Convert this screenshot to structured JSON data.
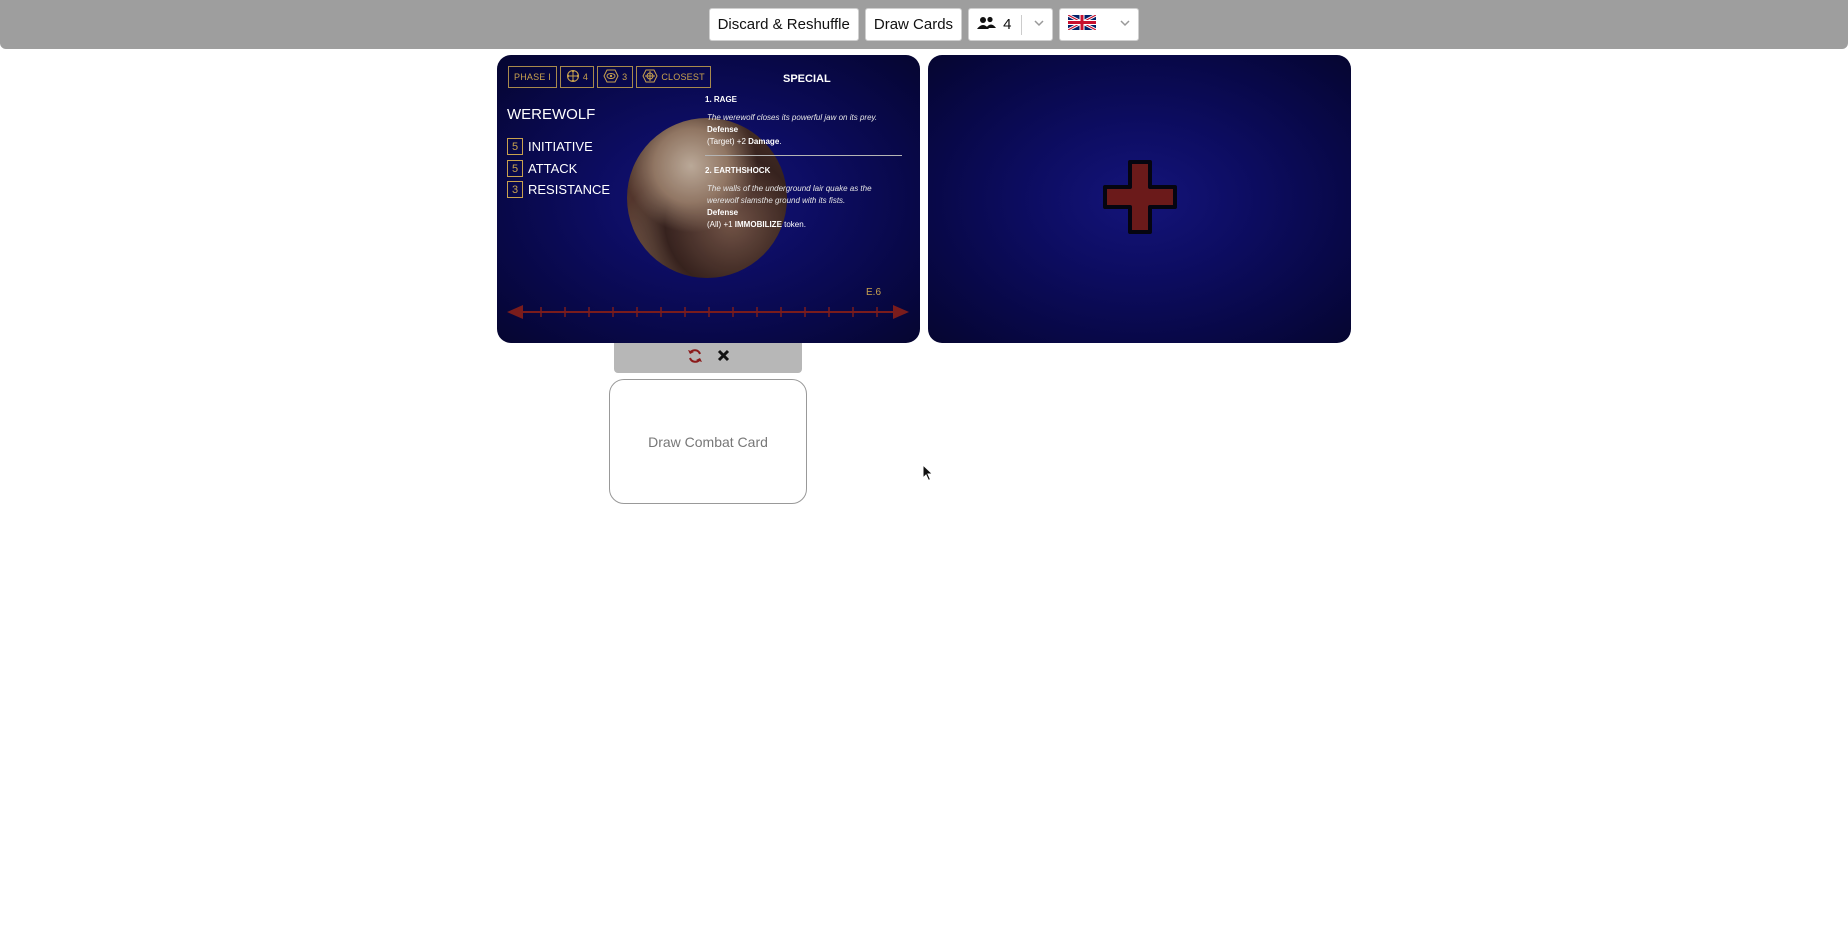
{
  "toolbar": {
    "discard_label": "Discard & Reshuffle",
    "draw_label": "Draw Cards",
    "players_value": "4",
    "language_flag": "uk-flag-icon"
  },
  "card": {
    "tags": {
      "phase": "PHASE I",
      "movement": "4",
      "range": "3",
      "targeting": "CLOSEST"
    },
    "name": "WEREWOLF",
    "stats": [
      {
        "value": "5",
        "label": "INITIATIVE"
      },
      {
        "value": "5",
        "label": "ATTACK"
      },
      {
        "value": "3",
        "label": "RESISTANCE"
      }
    ],
    "special_title": "SPECIAL",
    "abilities": [
      {
        "title": "1. RAGE",
        "flavor": "The werewolf closes its powerful jaw on its prey.",
        "type": "Defense",
        "effect_prefix": "(Target) +2 ",
        "effect_keyword": "Damage",
        "effect_suffix": "."
      },
      {
        "title": "2. EARTHSHOCK",
        "flavor": "The walls of the underground lair quake as the werewolf slamsthe ground with its fists.",
        "type": "Defense",
        "effect_prefix": "(All) +1 ",
        "effect_keyword": "IMMOBILIZE",
        "effect_suffix": " token."
      }
    ],
    "code": "E.6"
  },
  "draw_combat_label": "Draw Combat Card",
  "colors": {
    "gold": "#c9a24e",
    "card_blue": "#0d0d63",
    "track_red": "#7a1c1c",
    "plus_red": "#6b1a1a"
  }
}
